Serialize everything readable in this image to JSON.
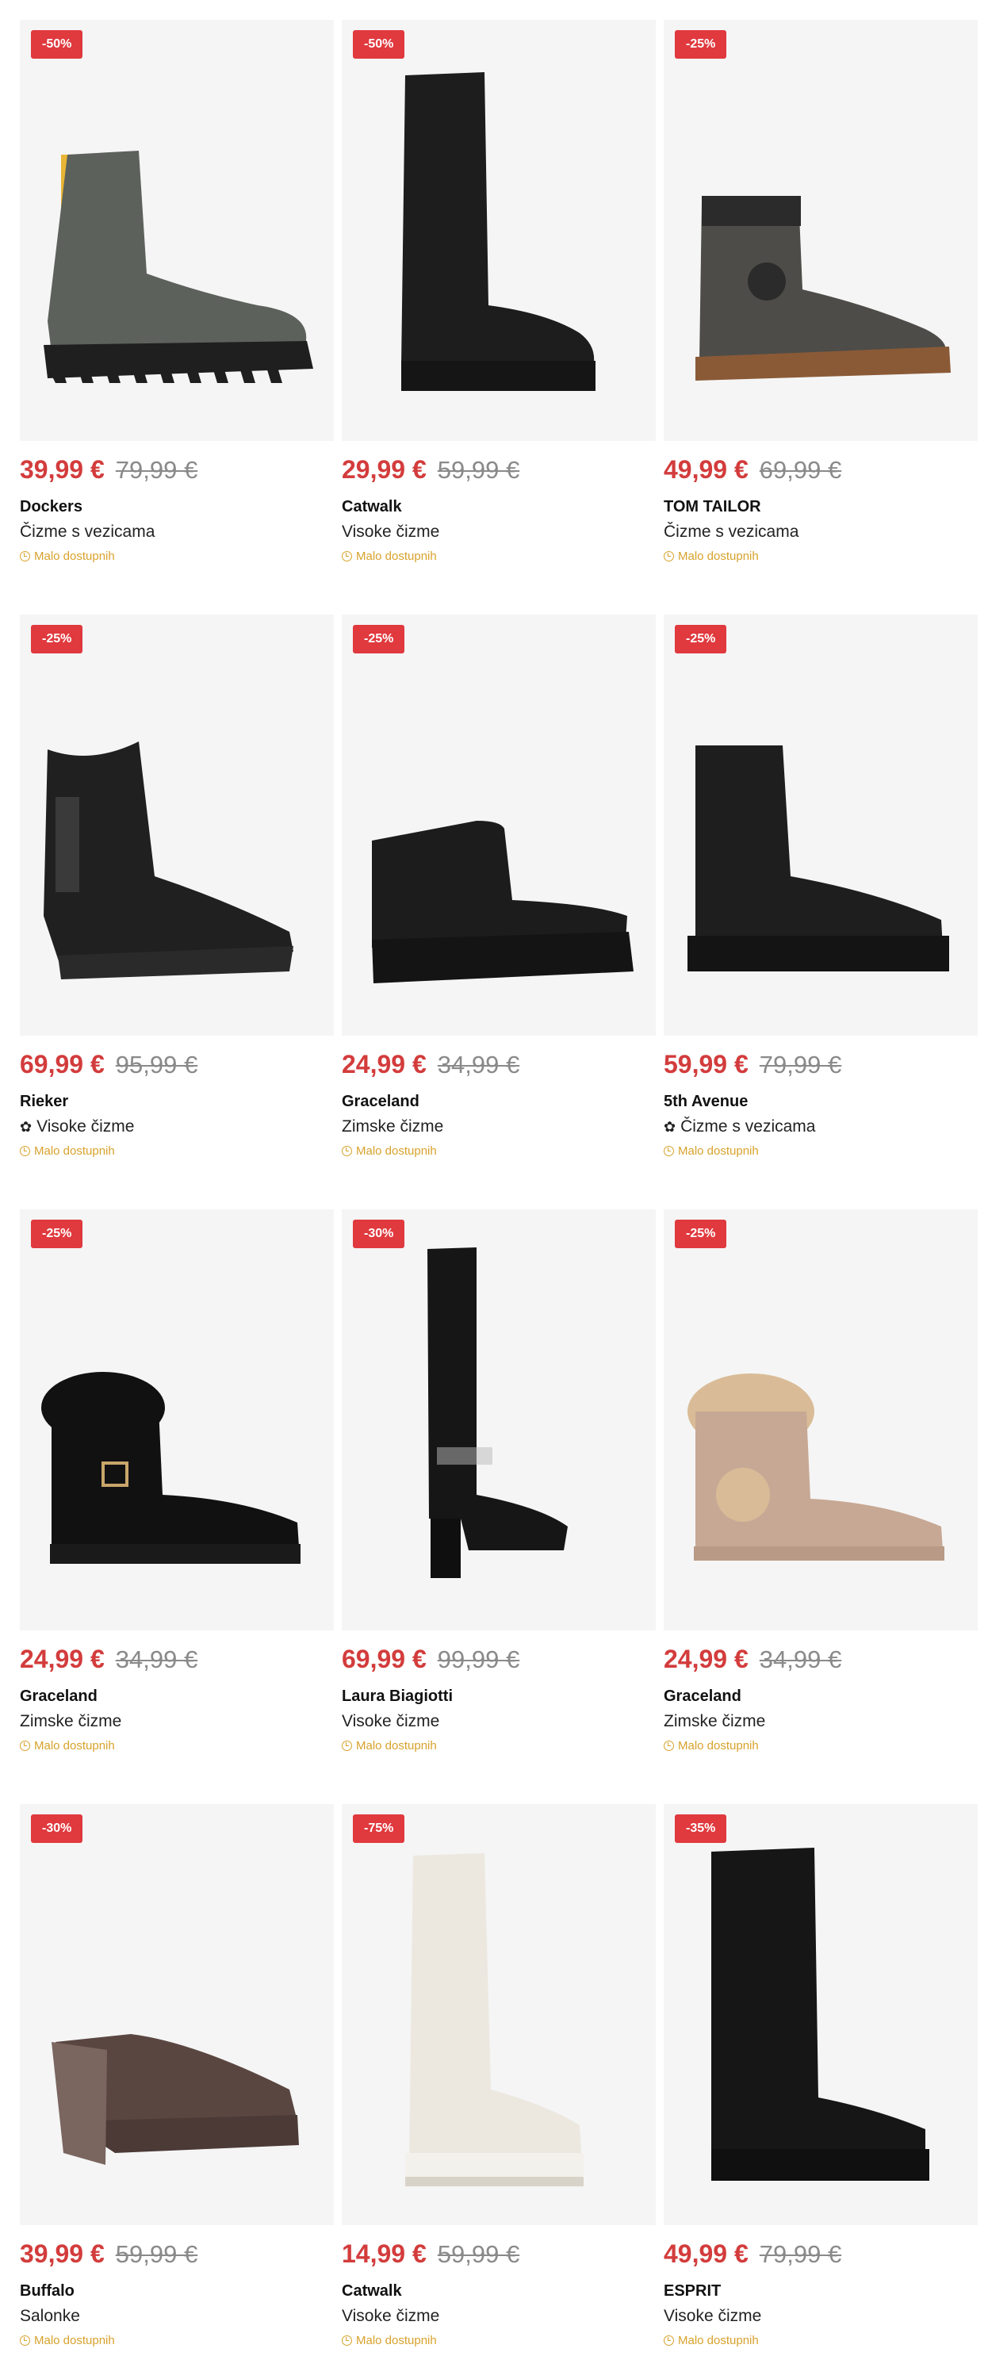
{
  "products": [
    {
      "badge": "-50%",
      "price": "39,99 €",
      "old_price": "79,99 €",
      "brand": "Dockers",
      "type": "Čizme s vezicama",
      "eco": false,
      "availability": "Malo dostupnih",
      "image": "boot-grey-yellow-icon",
      "colors": {
        "main": "#5d615c",
        "sole": "#1f1f1f",
        "accent": "#e9b535"
      }
    },
    {
      "badge": "-50%",
      "price": "29,99 €",
      "old_price": "59,99 €",
      "brand": "Catwalk",
      "type": "Visoke čizme",
      "eco": false,
      "availability": "Malo dostupnih",
      "image": "tall-boot-black-icon",
      "colors": {
        "main": "#1d1d1d",
        "sole": "#151515",
        "accent": "#333333"
      }
    },
    {
      "badge": "-25%",
      "price": "49,99 €",
      "old_price": "69,99 €",
      "brand": "TOM TAILOR",
      "type": "Čizme s vezicama",
      "eco": false,
      "availability": "Malo dostupnih",
      "image": "boot-grey-brown-sole-icon",
      "colors": {
        "main": "#4d4c48",
        "sole": "#8a5a37",
        "accent": "#2b2b2b"
      }
    },
    {
      "badge": "-25%",
      "price": "69,99 €",
      "old_price": "95,99 €",
      "brand": "Rieker",
      "type": "Visoke čizme",
      "eco": true,
      "availability": "Malo dostupnih",
      "image": "mid-boot-black-icon",
      "colors": {
        "main": "#202020",
        "sole": "#2a2a2a",
        "accent": "#3a3a3a"
      }
    },
    {
      "badge": "-25%",
      "price": "24,99 €",
      "old_price": "34,99 €",
      "brand": "Graceland",
      "type": "Zimske čizme",
      "eco": false,
      "availability": "Malo dostupnih",
      "image": "platform-bootie-black-icon",
      "colors": {
        "main": "#1c1c1c",
        "sole": "#141414",
        "accent": "#2e2e2e"
      }
    },
    {
      "badge": "-25%",
      "price": "59,99 €",
      "old_price": "79,99 €",
      "brand": "5th Avenue",
      "type": "Čizme s vezicama",
      "eco": true,
      "availability": "Malo dostupnih",
      "image": "lace-boot-black-icon",
      "colors": {
        "main": "#1e1e1e",
        "sole": "#141414",
        "accent": "#333333"
      }
    },
    {
      "badge": "-25%",
      "price": "24,99 €",
      "old_price": "34,99 €",
      "brand": "Graceland",
      "type": "Zimske čizme",
      "eco": false,
      "availability": "Malo dostupnih",
      "image": "fur-boot-black-icon",
      "colors": {
        "main": "#111111",
        "sole": "#1a1a1a",
        "accent": "#c9a66b"
      }
    },
    {
      "badge": "-30%",
      "price": "69,99 €",
      "old_price": "99,99 €",
      "brand": "Laura Biagiotti",
      "type": "Visoke čizme",
      "eco": false,
      "availability": "Malo dostupnih",
      "image": "heel-boot-black-icon",
      "colors": {
        "main": "#161616",
        "sole": "#0f0f0f",
        "accent": "#b9b9b9"
      }
    },
    {
      "badge": "-25%",
      "price": "24,99 €",
      "old_price": "34,99 €",
      "brand": "Graceland",
      "type": "Zimske čizme",
      "eco": false,
      "availability": "Malo dostupnih",
      "image": "fur-boot-beige-icon",
      "colors": {
        "main": "#c7a894",
        "sole": "#b89a86",
        "accent": "#d9bc97"
      }
    },
    {
      "badge": "-30%",
      "price": "39,99 €",
      "old_price": "59,99 €",
      "brand": "Buffalo",
      "type": "Salonke",
      "eco": false,
      "availability": "Malo dostupnih",
      "image": "mary-jane-brown-icon",
      "colors": {
        "main": "#5a4641",
        "sole": "#4b3a36",
        "accent": "#7a655f"
      }
    },
    {
      "badge": "-75%",
      "price": "14,99 €",
      "old_price": "59,99 €",
      "brand": "Catwalk",
      "type": "Visoke čizme",
      "eco": false,
      "availability": "Malo dostupnih",
      "image": "tall-boot-white-icon",
      "colors": {
        "main": "#ece8e0",
        "sole": "#f3f1ec",
        "accent": "#d8d3c9"
      }
    },
    {
      "badge": "-35%",
      "price": "49,99 €",
      "old_price": "79,99 €",
      "brand": "ESPRIT",
      "type": "Visoke čizme",
      "eco": false,
      "availability": "Malo dostupnih",
      "image": "tall-lace-boot-black-icon",
      "colors": {
        "main": "#161616",
        "sole": "#101010",
        "accent": "#2c2c2c"
      }
    }
  ]
}
